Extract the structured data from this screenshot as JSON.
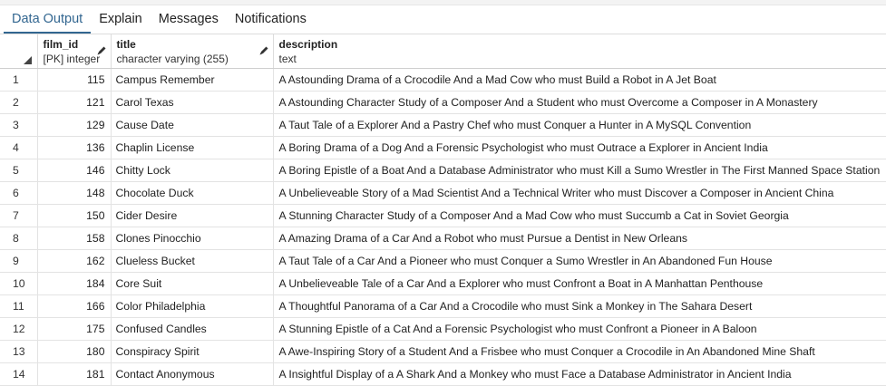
{
  "tabs": [
    {
      "label": "Data Output",
      "active": true
    },
    {
      "label": "Explain",
      "active": false
    },
    {
      "label": "Messages",
      "active": false
    },
    {
      "label": "Notifications",
      "active": false
    }
  ],
  "columns": [
    {
      "name": "film_id",
      "type": "[PK] integer",
      "icon": "pencil-icon"
    },
    {
      "name": "title",
      "type": "character varying (255)",
      "icon": "pencil-icon"
    },
    {
      "name": "description",
      "type": "text",
      "icon": ""
    }
  ],
  "rows": [
    {
      "n": "1",
      "film_id": "115",
      "title": "Campus Remember",
      "description": "A Astounding Drama of a Crocodile And a Mad Cow who must Build a Robot in A Jet Boat"
    },
    {
      "n": "2",
      "film_id": "121",
      "title": "Carol Texas",
      "description": "A Astounding Character Study of a Composer And a Student who must Overcome a Composer in A Monastery"
    },
    {
      "n": "3",
      "film_id": "129",
      "title": "Cause Date",
      "description": "A Taut Tale of a Explorer And a Pastry Chef who must Conquer a Hunter in A MySQL Convention"
    },
    {
      "n": "4",
      "film_id": "136",
      "title": "Chaplin License",
      "description": "A Boring Drama of a Dog And a Forensic Psychologist who must Outrace a Explorer in Ancient India"
    },
    {
      "n": "5",
      "film_id": "146",
      "title": "Chitty Lock",
      "description": "A Boring Epistle of a Boat And a Database Administrator who must Kill a Sumo Wrestler in The First Manned Space Station"
    },
    {
      "n": "6",
      "film_id": "148",
      "title": "Chocolate Duck",
      "description": "A Unbelieveable Story of a Mad Scientist And a Technical Writer who must Discover a Composer in Ancient China"
    },
    {
      "n": "7",
      "film_id": "150",
      "title": "Cider Desire",
      "description": "A Stunning Character Study of a Composer And a Mad Cow who must Succumb a Cat in Soviet Georgia"
    },
    {
      "n": "8",
      "film_id": "158",
      "title": "Clones Pinocchio",
      "description": "A Amazing Drama of a Car And a Robot who must Pursue a Dentist in New Orleans"
    },
    {
      "n": "9",
      "film_id": "162",
      "title": "Clueless Bucket",
      "description": "A Taut Tale of a Car And a Pioneer who must Conquer a Sumo Wrestler in An Abandoned Fun House"
    },
    {
      "n": "10",
      "film_id": "184",
      "title": "Core Suit",
      "description": "A Unbelieveable Tale of a Car And a Explorer who must Confront a Boat in A Manhattan Penthouse"
    },
    {
      "n": "11",
      "film_id": "166",
      "title": "Color Philadelphia",
      "description": "A Thoughtful Panorama of a Car And a Crocodile who must Sink a Monkey in The Sahara Desert"
    },
    {
      "n": "12",
      "film_id": "175",
      "title": "Confused Candles",
      "description": "A Stunning Epistle of a Cat And a Forensic Psychologist who must Confront a Pioneer in A Baloon"
    },
    {
      "n": "13",
      "film_id": "180",
      "title": "Conspiracy Spirit",
      "description": "A Awe-Inspiring Story of a Student And a Frisbee who must Conquer a Crocodile in An Abandoned Mine Shaft"
    },
    {
      "n": "14",
      "film_id": "181",
      "title": "Contact Anonymous",
      "description": "A Insightful Display of a A Shark And a Monkey who must Face a Database Administrator in Ancient India"
    }
  ],
  "colors": {
    "accent": "#326690",
    "grid_line": "#e3e3e3"
  }
}
